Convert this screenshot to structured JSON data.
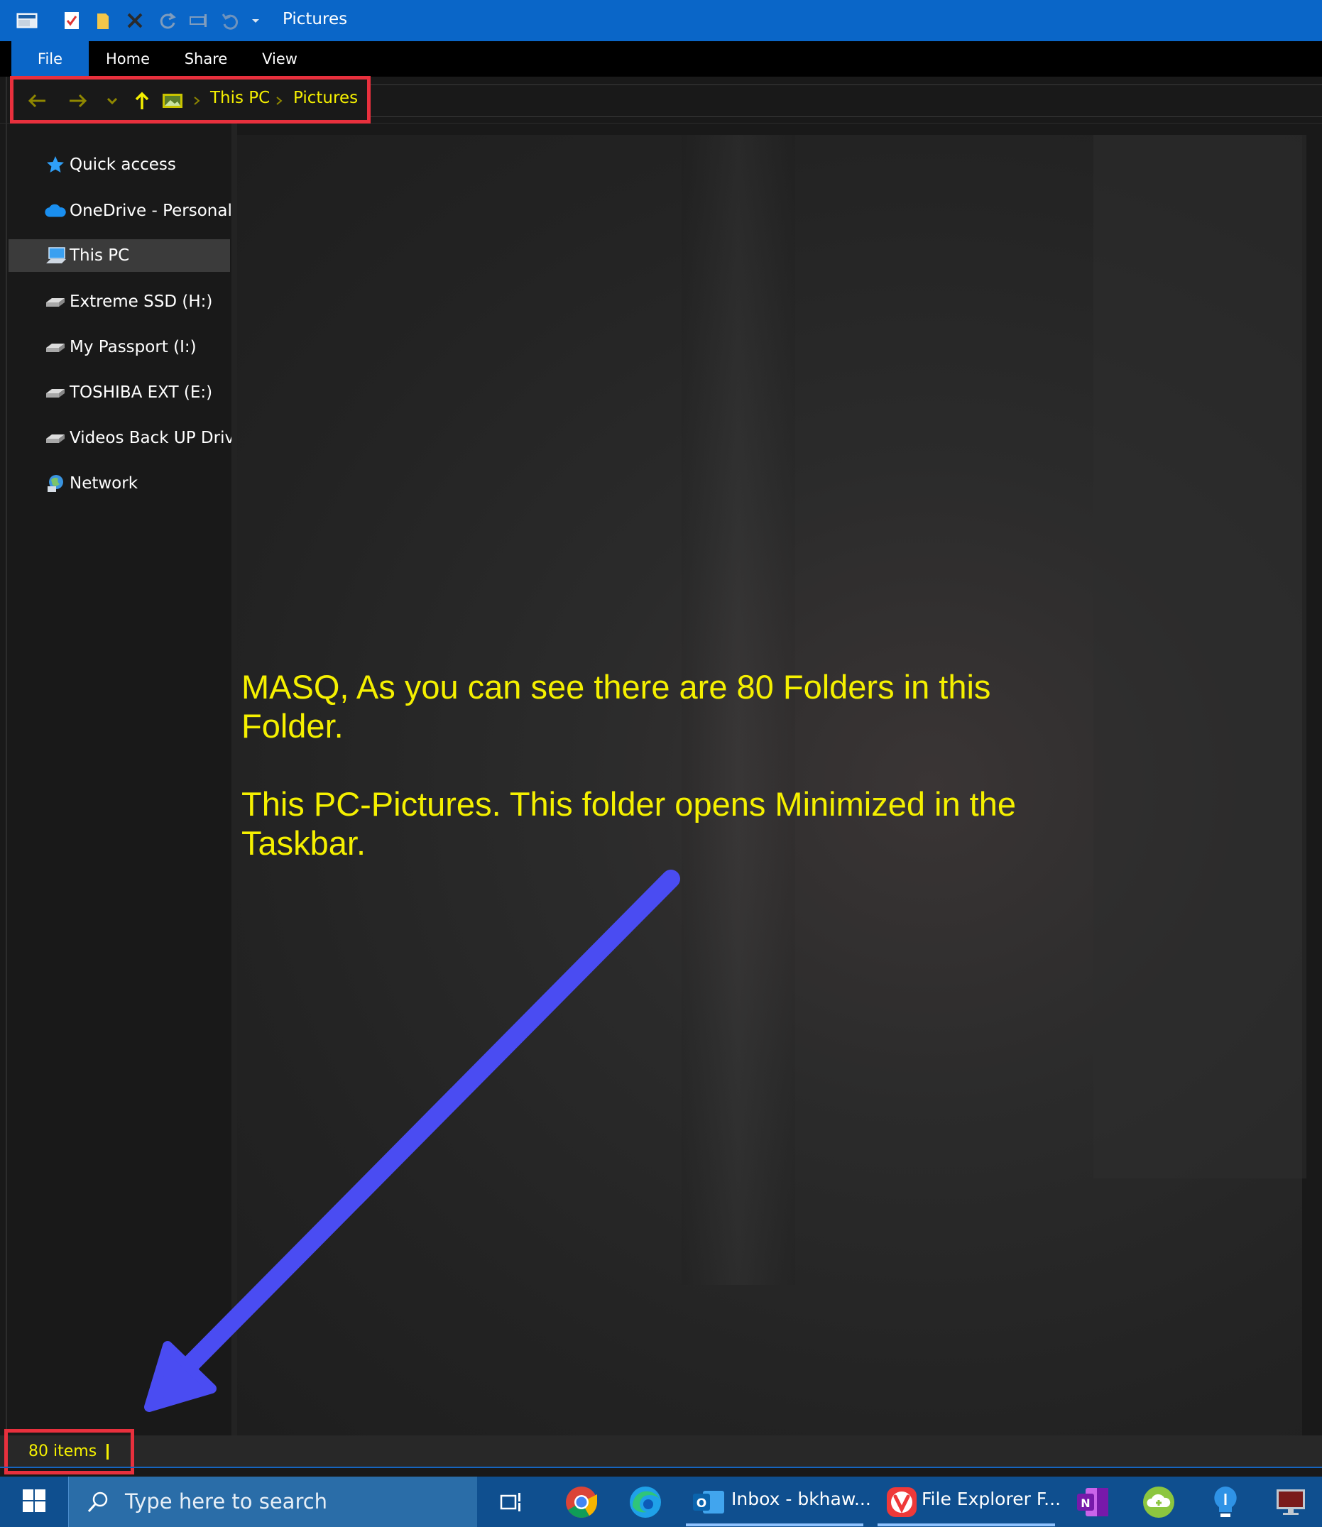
{
  "window": {
    "title": "Pictures"
  },
  "ribbon": {
    "tabs": [
      "File",
      "Home",
      "Share",
      "View"
    ]
  },
  "address": {
    "breadcrumbs": [
      "This PC",
      "Pictures"
    ]
  },
  "nav_pane": {
    "items": [
      {
        "label": "Quick access",
        "icon": "star-icon"
      },
      {
        "label": "OneDrive - Personal",
        "icon": "cloud-icon"
      },
      {
        "label": "This PC",
        "icon": "computer-icon",
        "selected": true
      },
      {
        "label": "Extreme SSD (H:)",
        "icon": "drive-icon"
      },
      {
        "label": "My Passport (I:)",
        "icon": "drive-icon"
      },
      {
        "label": "TOSHIBA EXT (E:)",
        "icon": "drive-icon"
      },
      {
        "label": "Videos Back UP Drive",
        "icon": "drive-icon"
      },
      {
        "label": "Network",
        "icon": "network-icon"
      }
    ]
  },
  "annotation": {
    "line1": "MASQ, As you can see there are 80 Folders in this Folder.",
    "line2": "This PC-Pictures. This folder opens Minimized in the Taskbar."
  },
  "status": {
    "item_count": "80 items"
  },
  "taskbar": {
    "search_placeholder": "Type here to search",
    "apps": [
      {
        "label": "Inbox - bkhaw...",
        "icon": "outlook-icon"
      },
      {
        "label": "File Explorer F...",
        "icon": "vivaldi-icon"
      }
    ]
  },
  "colors": {
    "accent_blue": "#0a66c8",
    "highlight_red": "#e8303d",
    "annotation_yellow": "#f5f000",
    "arrow_blue": "#4a4cf2"
  }
}
